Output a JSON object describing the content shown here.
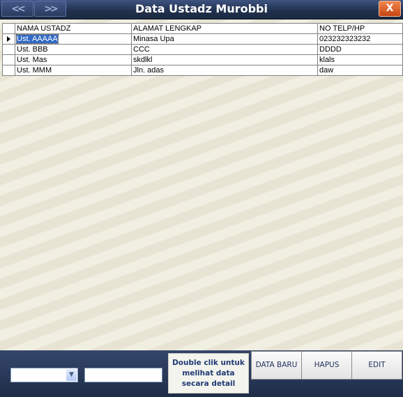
{
  "window": {
    "title": "Data Ustadz Murobbi",
    "nav_prev": "<<",
    "nav_next": ">>",
    "close": "X"
  },
  "grid": {
    "headers": [
      "NAMA USTADZ",
      "ALAMAT LENGKAP",
      "NO TELP/HP"
    ],
    "rows": [
      {
        "nama": "Ust. AAAAA",
        "alamat": "Minasa Upa",
        "telp": "023232323232"
      },
      {
        "nama": "Ust. BBB",
        "alamat": "CCC",
        "telp": "DDDD"
      },
      {
        "nama": "Ust. Mas",
        "alamat": "skdlkl",
        "telp": "klals"
      },
      {
        "nama": "Ust. MMM",
        "alamat": "Jln. adas",
        "telp": "daw"
      }
    ],
    "selected_row": 0
  },
  "footer": {
    "combo_value": "",
    "search_value": "",
    "hint_line1": "Double clik untuk",
    "hint_line2": "melihat data",
    "hint_line3": "secara detail",
    "btn_new": "DATA BARU",
    "btn_delete": "HAPUS",
    "btn_edit": "EDIT"
  }
}
